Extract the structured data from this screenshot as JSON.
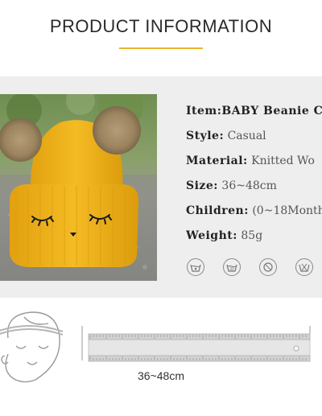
{
  "header": {
    "title": "PRODUCT INFORMATION"
  },
  "specs": [
    {
      "label": "Item:",
      "value": "BABY Beanie Ca"
    },
    {
      "label": "Style:",
      "value": "Casual"
    },
    {
      "label": "Material:",
      "value": "Knitted Wo"
    },
    {
      "label": "Size:",
      "value": "36~48cm"
    },
    {
      "label": "Children:",
      "value": "(0~18Month"
    },
    {
      "label": "Weight:",
      "value": "85g"
    }
  ],
  "care_icons": [
    "hand-wash-icon",
    "no-bleach-icon",
    "low-iron-icon",
    "dry-clean-icon"
  ],
  "measurement": {
    "size_text": "36~48cm"
  },
  "colors": {
    "accent": "#e8b52a",
    "panel": "#eeeeee",
    "hat": "#f2b51c"
  }
}
